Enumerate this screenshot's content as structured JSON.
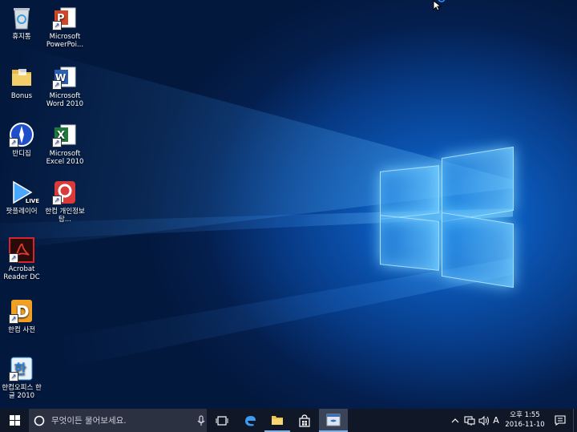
{
  "desktop": {
    "icons": [
      {
        "label": "휴지통",
        "icon": "recycle-bin-icon"
      },
      {
        "label": "Microsoft PowerPoi...",
        "icon": "powerpoint-icon"
      },
      {
        "label": "Bonus",
        "icon": "folder-icon"
      },
      {
        "label": "Microsoft Word 2010",
        "icon": "word-icon"
      },
      {
        "label": "반디집",
        "icon": "bandizip-icon"
      },
      {
        "label": "Microsoft Excel 2010",
        "icon": "excel-icon"
      },
      {
        "label": "팟플레이어",
        "icon": "potplayer-icon",
        "badge": "LIVE"
      },
      {
        "label": "한컴 개인정보탐...",
        "icon": "hancom-privacy-icon"
      },
      {
        "label": "Acrobat Reader DC",
        "icon": "acrobat-icon"
      },
      {
        "label": "한컴 사전",
        "icon": "hancom-dictionary-icon"
      },
      {
        "label": "한컴오피스 한글 2010",
        "icon": "hancom-office-icon"
      }
    ]
  },
  "taskbar": {
    "search_placeholder": "무엇이든 물어보세요.",
    "apps": [
      "edge-icon",
      "file-explorer-icon",
      "store-icon",
      "active-app-icon"
    ],
    "tray": {
      "ime": "A",
      "time": "오후 1:55",
      "date": "2016-11-10"
    }
  },
  "colors": {
    "taskbar": "#101726",
    "search_box": "#2b3141",
    "desktop_dark": "#03183d",
    "desktop_glow": "#0d7fe0"
  }
}
